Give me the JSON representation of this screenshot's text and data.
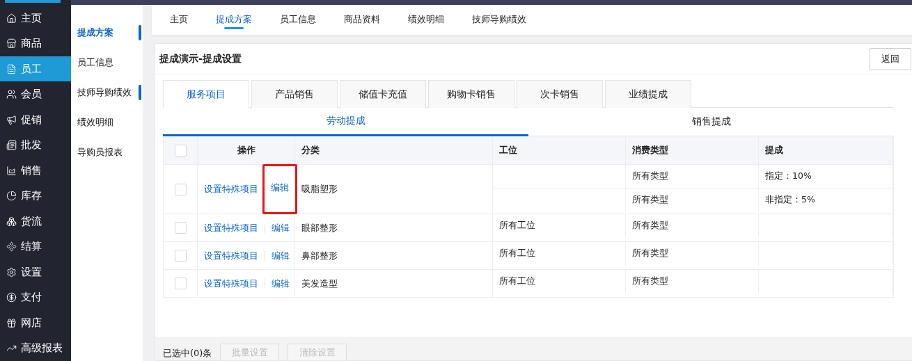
{
  "nav": [
    {
      "label": "主页",
      "selected": false
    },
    {
      "label": "商品",
      "selected": false
    },
    {
      "label": "员工",
      "selected": true
    },
    {
      "label": "会员",
      "selected": false
    },
    {
      "label": "促销",
      "selected": false
    },
    {
      "label": "批发",
      "selected": false
    },
    {
      "label": "销售",
      "selected": false
    },
    {
      "label": "库存",
      "selected": false
    },
    {
      "label": "货流",
      "selected": false
    },
    {
      "label": "结算",
      "selected": false
    },
    {
      "label": "设置",
      "selected": false
    },
    {
      "label": "支付",
      "selected": false
    },
    {
      "label": "网店",
      "selected": false
    },
    {
      "label": "高级报表",
      "selected": false
    }
  ],
  "subnav": [
    {
      "label": "提成方案",
      "selected": true,
      "marker": true
    },
    {
      "label": "员工信息",
      "selected": false,
      "marker": false
    },
    {
      "label": "技师导购绩效",
      "selected": false,
      "marker": true
    },
    {
      "label": "绩效明细",
      "selected": false,
      "marker": false
    },
    {
      "label": "导购员报表",
      "selected": false,
      "marker": false
    }
  ],
  "top_tabs": [
    {
      "label": "主页",
      "selected": false
    },
    {
      "label": "提成方案",
      "selected": true
    },
    {
      "label": "员工信息",
      "selected": false
    },
    {
      "label": "商品资料",
      "selected": false
    },
    {
      "label": "绩效明细",
      "selected": false
    },
    {
      "label": "技师导购绩效",
      "selected": false
    }
  ],
  "card": {
    "title": "提成演示-提成设置",
    "back_button": "返回"
  },
  "category_tabs": [
    {
      "label": "服务项目",
      "selected": true
    },
    {
      "label": "产品销售",
      "selected": false
    },
    {
      "label": "储值卡充值",
      "selected": false
    },
    {
      "label": "购物卡销售",
      "selected": false
    },
    {
      "label": "次卡销售",
      "selected": false
    },
    {
      "label": "业绩提成",
      "selected": false
    }
  ],
  "commission_tabs": [
    {
      "label": "劳动提成",
      "selected": true
    },
    {
      "label": "销售提成",
      "selected": false
    }
  ],
  "table": {
    "select_all_checked": false,
    "columns": [
      "操作",
      "分类",
      "工位",
      "消费类型",
      "提成"
    ],
    "rows": [
      {
        "checked": false,
        "actions": [
          "设置特殊项目",
          "编辑"
        ],
        "edit_outlined": true,
        "category": "吸脂塑形",
        "lines": [
          {
            "consume_type": "所有类型",
            "commission": "指定：10%"
          },
          {
            "consume_type": "所有类型",
            "commission": "非指定：5%"
          }
        ]
      },
      {
        "checked": false,
        "actions": [
          "设置特殊项目",
          "编辑"
        ],
        "edit_outlined": false,
        "category": "眼部整形",
        "lines": [
          {
            "station": "所有工位",
            "consume_type": "所有类型"
          }
        ]
      },
      {
        "checked": false,
        "actions": [
          "设置特殊项目",
          "编辑"
        ],
        "edit_outlined": false,
        "category": "鼻部整形",
        "lines": [
          {
            "station": "所有工位",
            "consume_type": "所有类型"
          }
        ]
      },
      {
        "checked": false,
        "actions": [
          "设置特殊项目",
          "编辑"
        ],
        "edit_outlined": false,
        "category": "美发造型",
        "lines": [
          {
            "station": "所有工位",
            "consume_type": "所有类型"
          }
        ]
      }
    ]
  },
  "footer": {
    "selected_count": "已选中(0)条",
    "buttons": [
      {
        "label": "批量设置",
        "disabled": true
      },
      {
        "label": "清除设置",
        "disabled": true
      }
    ]
  }
}
